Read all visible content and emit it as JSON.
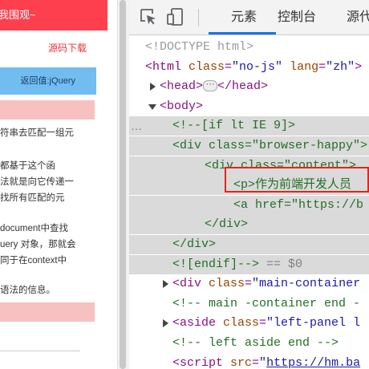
{
  "preview": {
    "banner": "我围观~",
    "source_link": "源码下载",
    "return_button": "返回值:jQuery",
    "paragraphs": [
      "符串去匹配一组元",
      "都基于这个函",
      "法就是向它传递一",
      "找所有匹配的元",
      "document中查找",
      "uery 对象，那就会",
      "同于在context中",
      "语法的信息。"
    ]
  },
  "devtools": {
    "tabs": [
      "元素",
      "控制台",
      "源代"
    ],
    "lines": [
      {
        "parts": [
          [
            "gray",
            "<!DOCTYPE html>"
          ]
        ]
      },
      {
        "parts": [
          [
            "tag",
            "<html "
          ],
          [
            "an",
            "class"
          ],
          [
            "tag",
            "="
          ],
          [
            "av",
            "\"no-js\""
          ],
          [
            "tag",
            " "
          ],
          [
            "an",
            "lang"
          ],
          [
            "tag",
            "="
          ],
          [
            "av",
            "\"zh\""
          ],
          [
            "tag",
            ">"
          ]
        ]
      },
      {
        "parts": [
          [
            "tag",
            "<head>"
          ],
          [
            "ell",
            "···"
          ],
          [
            "tag",
            "</head>"
          ]
        ]
      },
      {
        "parts": [
          [
            "tag",
            "<body>"
          ]
        ]
      },
      {
        "parts": [
          [
            "cm",
            "<!--[if lt IE 9]>"
          ]
        ]
      },
      {
        "parts": [
          [
            "cm",
            "<div class=\"browser-happy\">"
          ]
        ]
      },
      {
        "parts": [
          [
            "cm",
            "<div class=\"content\">"
          ]
        ]
      },
      {
        "parts": [
          [
            "cm",
            "<p>作为前端开发人员"
          ]
        ]
      },
      {
        "parts": [
          [
            "cm",
            "<a href=\"https://b"
          ]
        ]
      },
      {
        "parts": [
          [
            "cm",
            "</div>"
          ]
        ]
      },
      {
        "parts": [
          [
            "cm",
            "</div>"
          ]
        ]
      },
      {
        "parts": [
          [
            "cm",
            "<![endif]-->"
          ],
          [
            "dt",
            " == $0"
          ]
        ]
      },
      {
        "parts": [
          [
            "tag",
            "<div "
          ],
          [
            "an",
            "class"
          ],
          [
            "tag",
            "="
          ],
          [
            "av",
            "\"main-container"
          ]
        ]
      },
      {
        "parts": [
          [
            "cm",
            "<!-- main -container end -"
          ]
        ]
      },
      {
        "parts": [
          [
            "tag",
            "<aside "
          ],
          [
            "an",
            "class"
          ],
          [
            "tag",
            "="
          ],
          [
            "av",
            "\"left-panel l"
          ]
        ]
      },
      {
        "parts": [
          [
            "cm",
            "<!-- left aside end -->"
          ]
        ]
      },
      {
        "parts": [
          [
            "tag",
            "<script "
          ],
          [
            "an",
            "src"
          ],
          [
            "tag",
            "="
          ],
          [
            "av",
            "\""
          ],
          [
            "link",
            "https://hm.ba"
          ]
        ]
      }
    ],
    "selection_dots": "…"
  }
}
